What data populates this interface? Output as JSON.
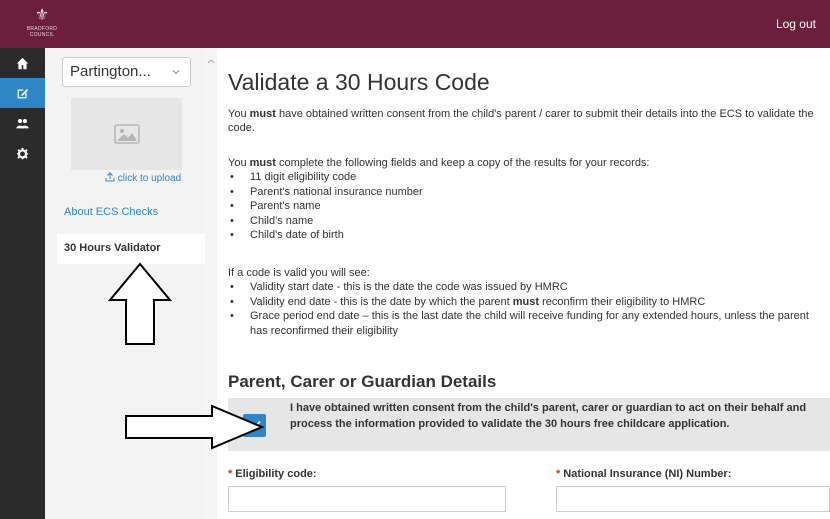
{
  "header": {
    "logo_text": "BRADFORD COUNCIL",
    "logout_label": "Log out",
    "bg_color": "#6b1f3a"
  },
  "nav": {
    "icons": [
      "home-icon",
      "edit-icon",
      "users-icon",
      "gear-icon"
    ],
    "active_index": 1,
    "accent": "#2f86c6"
  },
  "sidebar": {
    "org_select_value": "Partington...",
    "upload_label": "click to upload",
    "links": [
      {
        "label": "About ECS Checks",
        "active": false
      },
      {
        "label": "30 Hours Validator",
        "active": true
      }
    ]
  },
  "main": {
    "title": "Validate a 30 Hours Code",
    "consent_intro": {
      "pre": "You ",
      "strong": "must",
      "post": " have obtained written consent from the child's parent / carer to submit their details into the ECS to validate the code."
    },
    "fields_intro": {
      "pre": "You ",
      "strong": "must",
      "post": " complete the following fields and keep a copy of the results for your records:"
    },
    "required_fields": [
      "11 digit eligibility code",
      "Parent's national insurance number",
      "Parent's name",
      "Child's name",
      "Child's date of birth"
    ],
    "valid_intro": "If a code is valid you will see:",
    "valid_items": [
      {
        "pre": "Validity start date - this is the date the code was issued by HMRC",
        "strong": "",
        "post": ""
      },
      {
        "pre": "Validity end date - this is the date by which the parent ",
        "strong": "must",
        "post": " reconfirm their eligibility to HMRC"
      },
      {
        "pre": "Grace period end date – this is the last date the child will receive funding for any extended hours, unless the parent has reconfirmed their eligibility",
        "strong": "",
        "post": ""
      }
    ],
    "section_title": "Parent, Carer or Guardian Details",
    "consent_checkbox": {
      "checked": true,
      "label": "I have obtained written consent from the child's parent, carer or guardian to act on their behalf and process the information provided to validate the 30 hours free childcare application."
    },
    "form": {
      "eligibility_label": "Eligibility code:",
      "eligibility_value": "",
      "ni_label": "National Insurance (NI) Number:",
      "ni_value": "",
      "required_marker": "*"
    }
  }
}
